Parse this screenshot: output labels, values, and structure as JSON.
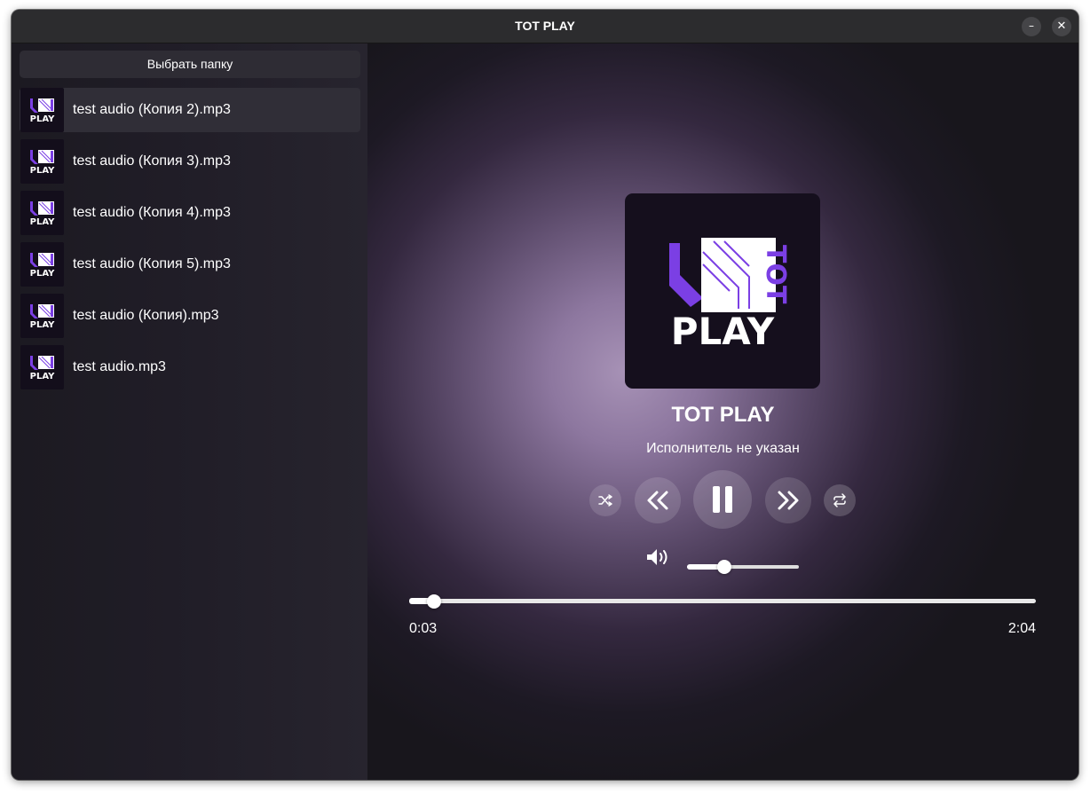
{
  "window": {
    "title": "TOT PLAY",
    "minimize_label": "–",
    "close_label": "✕"
  },
  "sidebar": {
    "folder_button": "Выбрать папку",
    "thumb_text": "PLAY",
    "tracks": [
      {
        "name": "test audio (Копия 2).mp3",
        "active": true
      },
      {
        "name": "test audio (Копия 3).mp3",
        "active": false
      },
      {
        "name": "test audio (Копия 4).mp3",
        "active": false
      },
      {
        "name": "test audio (Копия 5).mp3",
        "active": false
      },
      {
        "name": "test audio (Копия).mp3",
        "active": false
      },
      {
        "name": "test audio.mp3",
        "active": false
      }
    ]
  },
  "player": {
    "art": {
      "logo_word": "PLAY",
      "logo_vertical": "ТОТ"
    },
    "title": "TOT PLAY",
    "artist": "Исполнитель не указан",
    "controls": {
      "shuffle": "shuffle-icon",
      "previous": "previous-icon",
      "play_state": "pause-icon",
      "next": "next-icon",
      "repeat": "repeat-icon"
    },
    "volume": {
      "icon": "volume-icon",
      "level": 0.33
    },
    "progress": {
      "elapsed": "0:03",
      "total": "2:04",
      "fraction": 0.04
    }
  },
  "colors": {
    "accent": "#7b3fe4",
    "sidebar_bg": "#1f1c25",
    "titlebar_bg": "#2c2c2e"
  }
}
